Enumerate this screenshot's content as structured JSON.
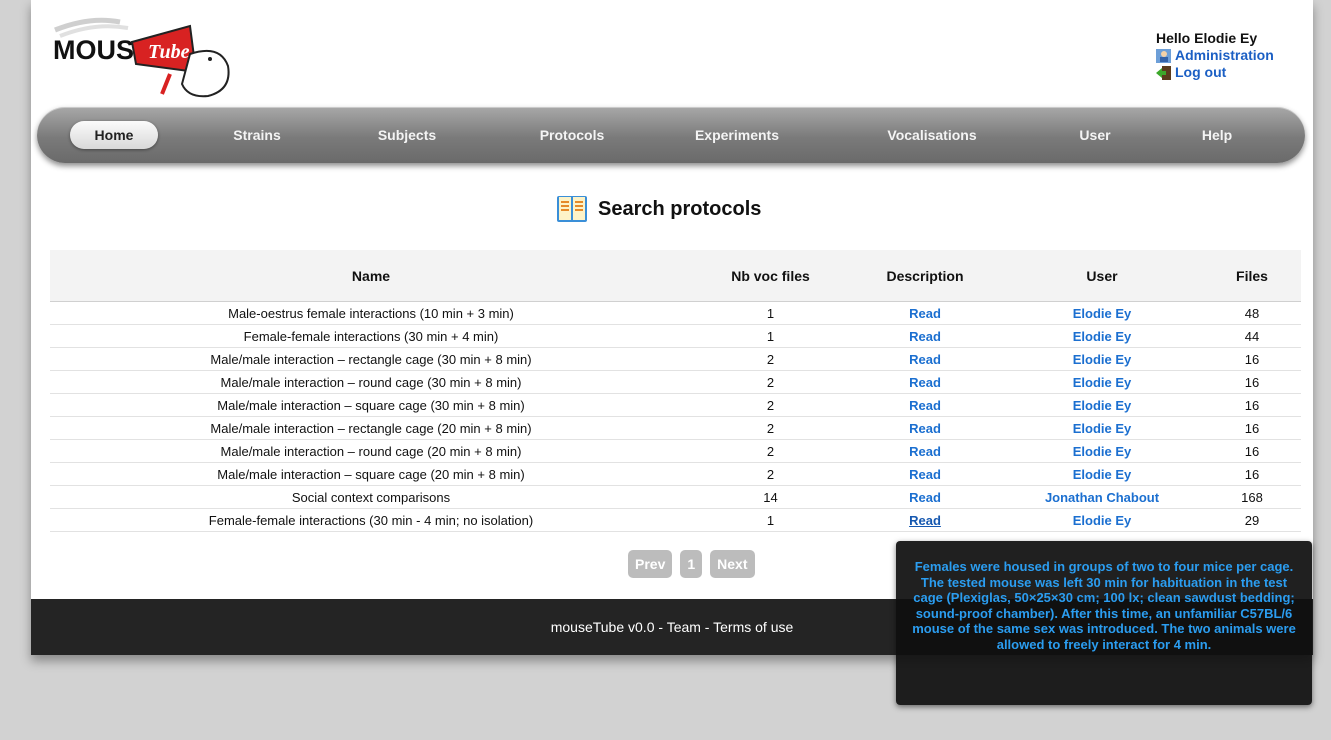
{
  "logo": {
    "text_mouse": "MOUSE",
    "text_tube": "Tube"
  },
  "user": {
    "greeting": "Hello Elodie Ey",
    "admin_label": "Administration",
    "logout_label": "Log out"
  },
  "nav": [
    "Home",
    "Strains",
    "Subjects",
    "Protocols",
    "Experiments",
    "Vocalisations",
    "User",
    "Help"
  ],
  "page_title": "Search protocols",
  "table": {
    "headers": [
      "Name",
      "Nb voc files",
      "Description",
      "User",
      "Files"
    ],
    "rows": [
      [
        "Male-oestrus female interactions (10 min + 3 min)",
        "1",
        "Read",
        "Elodie Ey",
        "48"
      ],
      [
        "Female-female interactions (30 min + 4 min)",
        "1",
        "Read",
        "Elodie Ey",
        "44"
      ],
      [
        "Male/male interaction – rectangle cage (30 min + 8 min)",
        "2",
        "Read",
        "Elodie Ey",
        "16"
      ],
      [
        "Male/male interaction – round cage (30 min + 8 min)",
        "2",
        "Read",
        "Elodie Ey",
        "16"
      ],
      [
        "Male/male interaction – square cage (30 min + 8 min)",
        "2",
        "Read",
        "Elodie Ey",
        "16"
      ],
      [
        "Male/male interaction – rectangle cage (20 min + 8 min)",
        "2",
        "Read",
        "Elodie Ey",
        "16"
      ],
      [
        "Male/male interaction – round cage (20 min + 8 min)",
        "2",
        "Read",
        "Elodie Ey",
        "16"
      ],
      [
        "Male/male interaction – square cage (20 min + 8 min)",
        "2",
        "Read",
        "Elodie Ey",
        "16"
      ],
      [
        "Social context comparisons",
        "14",
        "Read",
        "Jonathan Chabout",
        "168"
      ],
      [
        "Female-female interactions (30 min - 4 min; no isolation)",
        "1",
        "Read",
        "Elodie Ey",
        "29"
      ]
    ]
  },
  "pager": {
    "prev": "Prev",
    "page": "1",
    "next": "Next"
  },
  "footer": {
    "app": "mouseTube v0.0",
    "sep": " - ",
    "team": "Team",
    "terms": "Terms of use"
  },
  "tooltip": "Females were housed in groups of two to four mice per cage. The tested mouse was left 30 min for habituation in the test cage (Plexiglas, 50×25×30 cm; 100 lx; clean sawdust bedding; sound-proof chamber). After this time, an unfamiliar C57BL/6 mouse of the same sex was introduced. The two animals were allowed to freely interact for 4 min.",
  "colors": {
    "link": "#1b6fd0",
    "tooltip_text": "#2b9df0",
    "footer_bg": "#242424"
  }
}
